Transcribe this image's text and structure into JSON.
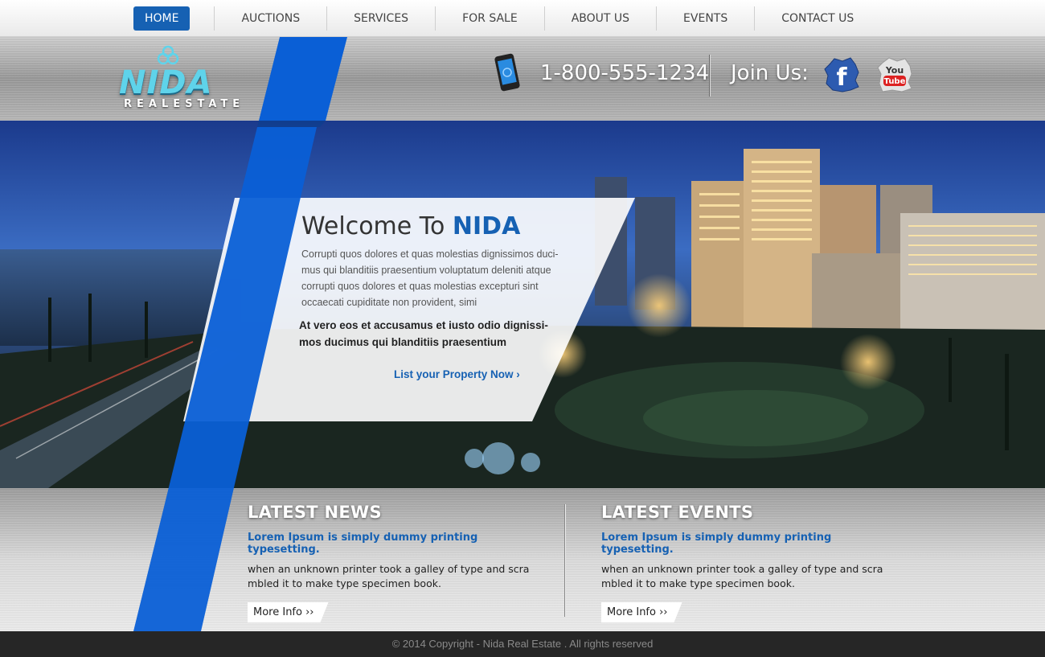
{
  "nav": {
    "items": [
      {
        "label": "HOME",
        "active": true
      },
      {
        "label": "AUCTIONS"
      },
      {
        "label": "SERVICES"
      },
      {
        "label": "FOR SALE"
      },
      {
        "label": "ABOUT US"
      },
      {
        "label": "EVENTS"
      },
      {
        "label": "CONTACT US"
      }
    ]
  },
  "header": {
    "logo_text": "NIDA",
    "logo_subtext": "REALESTATE",
    "phone": "1-800-555-1234",
    "join_label": "Join Us:",
    "social": [
      {
        "icon": "facebook-icon",
        "label": "f"
      },
      {
        "icon": "youtube-icon",
        "label": "You Tube"
      }
    ]
  },
  "welcome": {
    "title_prefix": "Welcome To ",
    "title_brand": "NIDA",
    "paragraph": "Corrupti quos dolores et quas molestias dignissimos duci-mus qui blanditiis praesentium voluptatum deleniti atque corrupti quos dolores et quas molestias excepturi sint occaecati cupiditate non provident, simi",
    "highlight": "At vero eos et accusamus et iusto odio dignissi-mos ducimus qui blanditiis praesentium",
    "cta": "List your Property Now ›"
  },
  "news": {
    "title": "LATEST NEWS",
    "subtitle": "Lorem Ipsum is simply dummy printing  typesetting.",
    "text": "when an unknown printer took a galley of type and scra mbled it to make type specimen book.",
    "button": "More Info ››"
  },
  "events": {
    "title": "LATEST EVENTS",
    "subtitle": "Lorem Ipsum is simply dummy printing  typesetting.",
    "text": "when an unknown printer took a galley of type and scra mbled it to make type specimen book.",
    "button": "More Info ››"
  },
  "footer": {
    "copyright": "© 2014 Copyright - Nida Real Estate . All rights reserved"
  },
  "colors": {
    "accent": "#1661b3",
    "stripe": "#0a5fd6",
    "footer_bg": "#262626"
  }
}
